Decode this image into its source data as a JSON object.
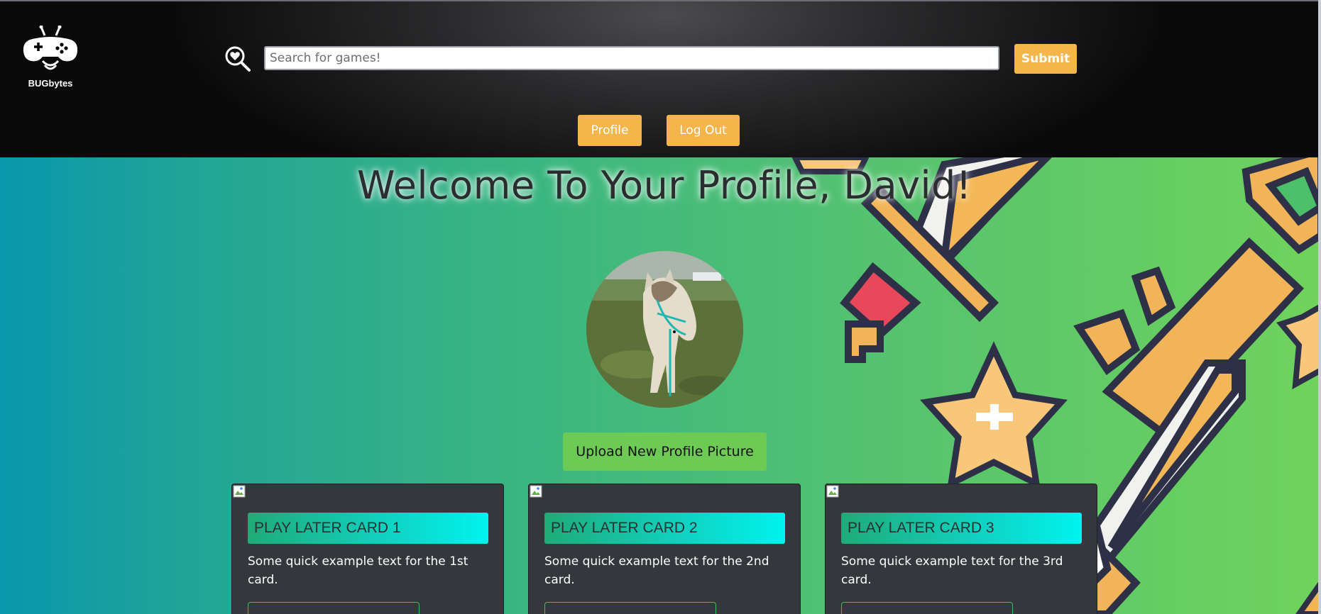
{
  "header": {
    "logo_text": "BUGbytes",
    "search": {
      "placeholder": "Search for games!",
      "value": ""
    },
    "submit_label": "Submit",
    "nav": {
      "profile_label": "Profile",
      "logout_label": "Log Out"
    },
    "accent": "#f5b54a"
  },
  "main": {
    "welcome": "Welcome To Your Profile, David!",
    "upload_label": "Upload New Profile Picture",
    "cards": [
      {
        "title": "PLAY LATER CARD 1",
        "text": "Some quick example text for the 1st card."
      },
      {
        "title": "PLAY LATER CARD 2",
        "text": "Some quick example text for the 2nd card."
      },
      {
        "title": "PLAY LATER CARD 3",
        "text": "Some quick example text for the 3rd card."
      }
    ]
  },
  "icons": [
    "gamepad-bug-logo-icon",
    "search-heart-icon",
    "broken-image-icon"
  ]
}
